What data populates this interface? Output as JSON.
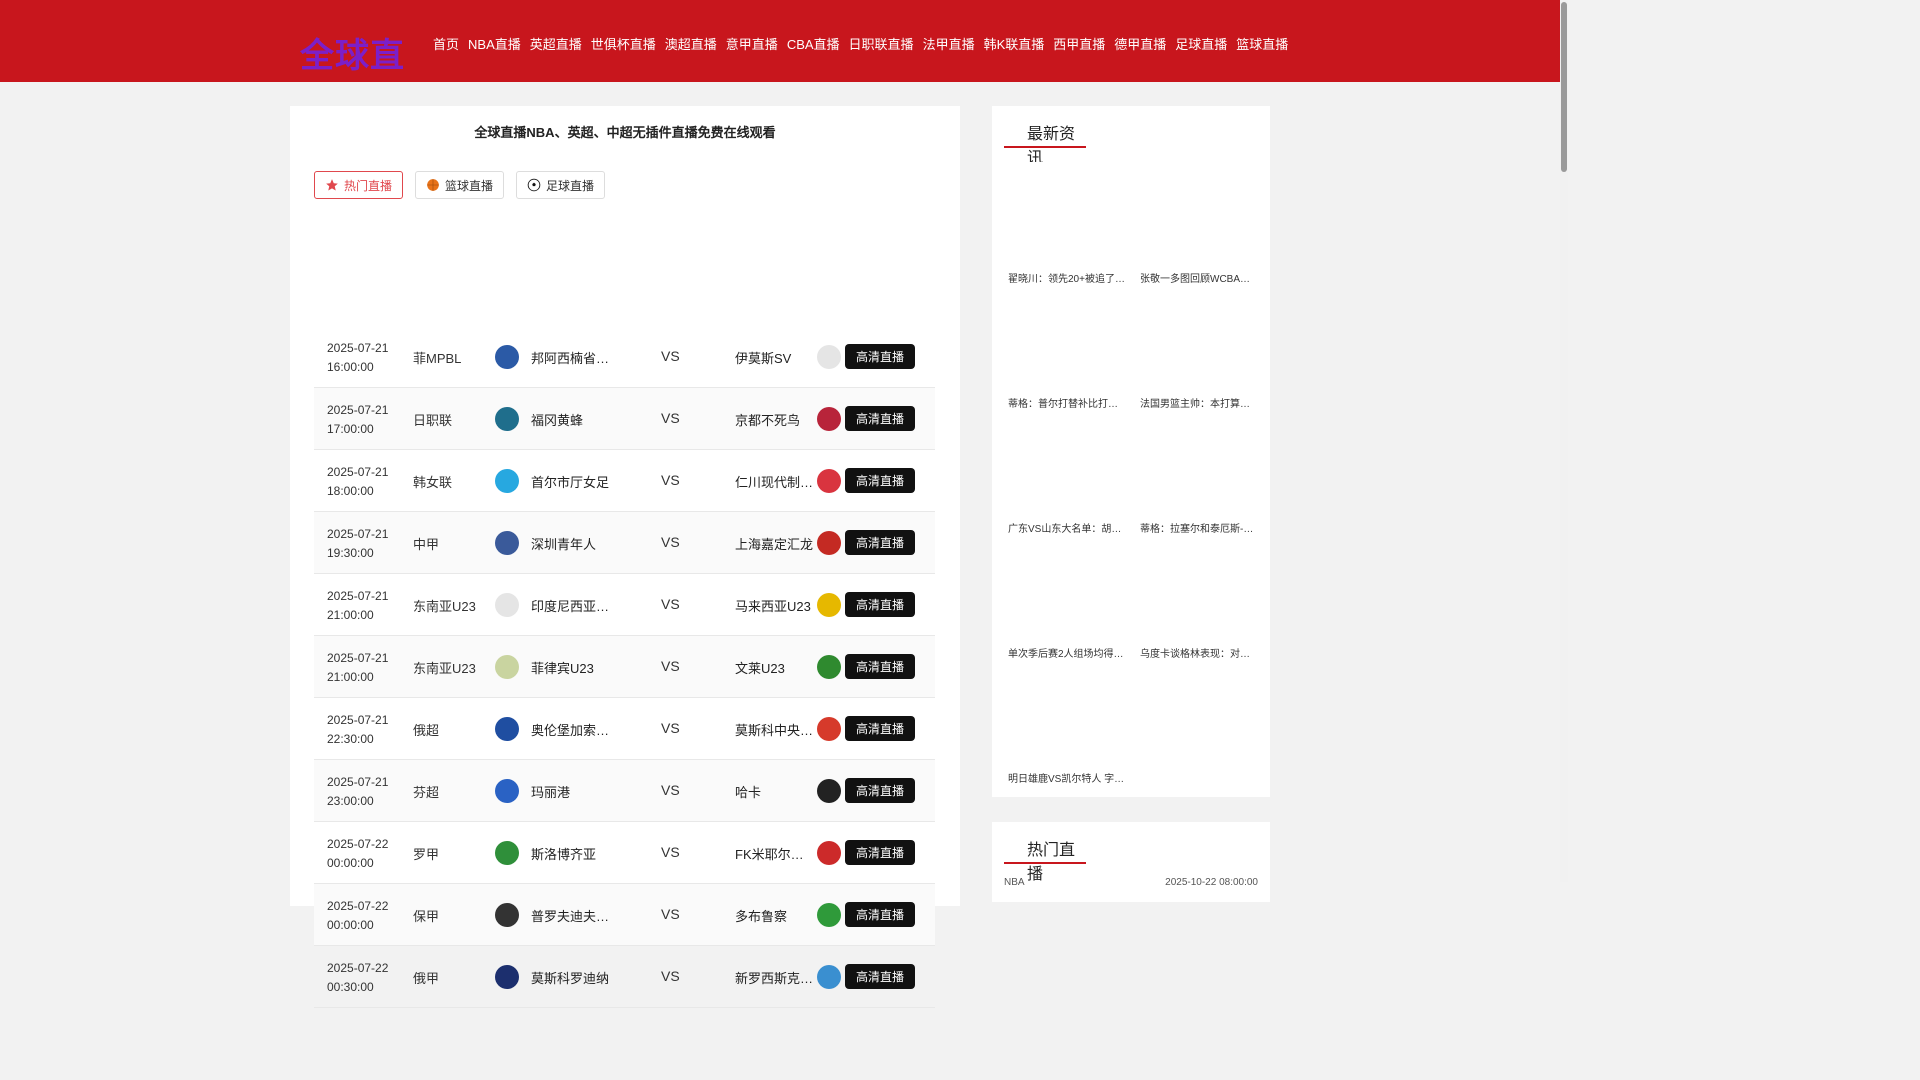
{
  "header": {
    "logo": "全球直",
    "nav": [
      "首页",
      "NBA直播",
      "英超直播",
      "世俱杯直播",
      "澳超直播",
      "意甲直播",
      "CBA直播",
      "日职联直播",
      "法甲直播",
      "韩K联直播",
      "西甲直播",
      "德甲直播",
      "足球直播",
      "篮球直播"
    ]
  },
  "main": {
    "title": "全球直播NBA、英超、中超无插件直播免费在线观看",
    "tabs": [
      {
        "label": "热门直播",
        "icon": "star-icon"
      },
      {
        "label": "篮球直播",
        "icon": "basketball-icon"
      },
      {
        "label": "足球直播",
        "icon": "soccer-ball-icon"
      }
    ],
    "vs": "VS",
    "watch_label": "高清直播",
    "matches": [
      {
        "date": "2025-07-21",
        "time": "16:00:00",
        "league": "菲MPBL",
        "home": "邦阿西楠省…",
        "away": "伊莫斯SV",
        "home_color": "#2b5aa6",
        "away_color": "#e5e5e5"
      },
      {
        "date": "2025-07-21",
        "time": "17:00:00",
        "league": "日职联",
        "home": "福冈黄蜂",
        "away": "京都不死鸟",
        "home_color": "#1f6e8c",
        "away_color": "#b8243a"
      },
      {
        "date": "2025-07-21",
        "time": "18:00:00",
        "league": "韩女联",
        "home": "首尔市厅女足",
        "away": "仁川现代制…",
        "home_color": "#27a8e0",
        "away_color": "#d9343f"
      },
      {
        "date": "2025-07-21",
        "time": "19:30:00",
        "league": "中甲",
        "home": "深圳青年人",
        "away": "上海嘉定汇龙",
        "home_color": "#3a5a9a",
        "away_color": "#c42a23"
      },
      {
        "date": "2025-07-21",
        "time": "21:00:00",
        "league": "东南亚U23",
        "home": "印度尼西亚…",
        "away": "马来西亚U23",
        "home_color": "#e5e5e5",
        "away_color": "#e6b800"
      },
      {
        "date": "2025-07-21",
        "time": "21:00:00",
        "league": "东南亚U23",
        "home": "菲律宾U23",
        "away": "文莱U23",
        "home_color": "#c9d4a0",
        "away_color": "#2f8a2f"
      },
      {
        "date": "2025-07-21",
        "time": "22:30:00",
        "league": "俄超",
        "home": "奥伦堡加索…",
        "away": "莫斯科中央…",
        "home_color": "#1f4ea1",
        "away_color": "#d63a2b"
      },
      {
        "date": "2025-07-21",
        "time": "23:00:00",
        "league": "芬超",
        "home": "玛丽港",
        "away": "哈卡",
        "home_color": "#2a62c4",
        "away_color": "#222222"
      },
      {
        "date": "2025-07-22",
        "time": "00:00:00",
        "league": "罗甲",
        "home": "斯洛博齐亚",
        "away": "FK米耶尔库…",
        "home_color": "#2f8f3a",
        "away_color": "#cc2a2a"
      },
      {
        "date": "2025-07-22",
        "time": "00:00:00",
        "league": "保甲",
        "home": "普罗夫迪夫…",
        "away": "多布鲁察",
        "home_color": "#333333",
        "away_color": "#2f9a3a"
      },
      {
        "date": "2025-07-22",
        "time": "00:30:00",
        "league": "俄甲",
        "home": "莫斯科罗迪纳",
        "away": "新罗西斯克…",
        "home_color": "#1c2f6e",
        "away_color": "#3a8fd0"
      }
    ]
  },
  "sidebar": {
    "news_title": "最新资讯",
    "news": [
      "翟晓川：领先20+被追了…",
      "张敬一多图回顾WCBA全…",
      "蒂格：普尔打替补比打首…",
      "法国男篮主帅：本打算派…",
      "广东VS山东大名单：胡明…",
      "蒂格：拉塞尔和泰厄斯-琼…",
      "单次季后赛2人组场均得…",
      "乌度卡谈格林表现：对自…",
      "明日雄鹿VS凯尔特人 字…"
    ],
    "hot_title": "热门直播",
    "hot_first": {
      "league": "NBA",
      "time": "2025-10-22 08:00:00"
    }
  }
}
